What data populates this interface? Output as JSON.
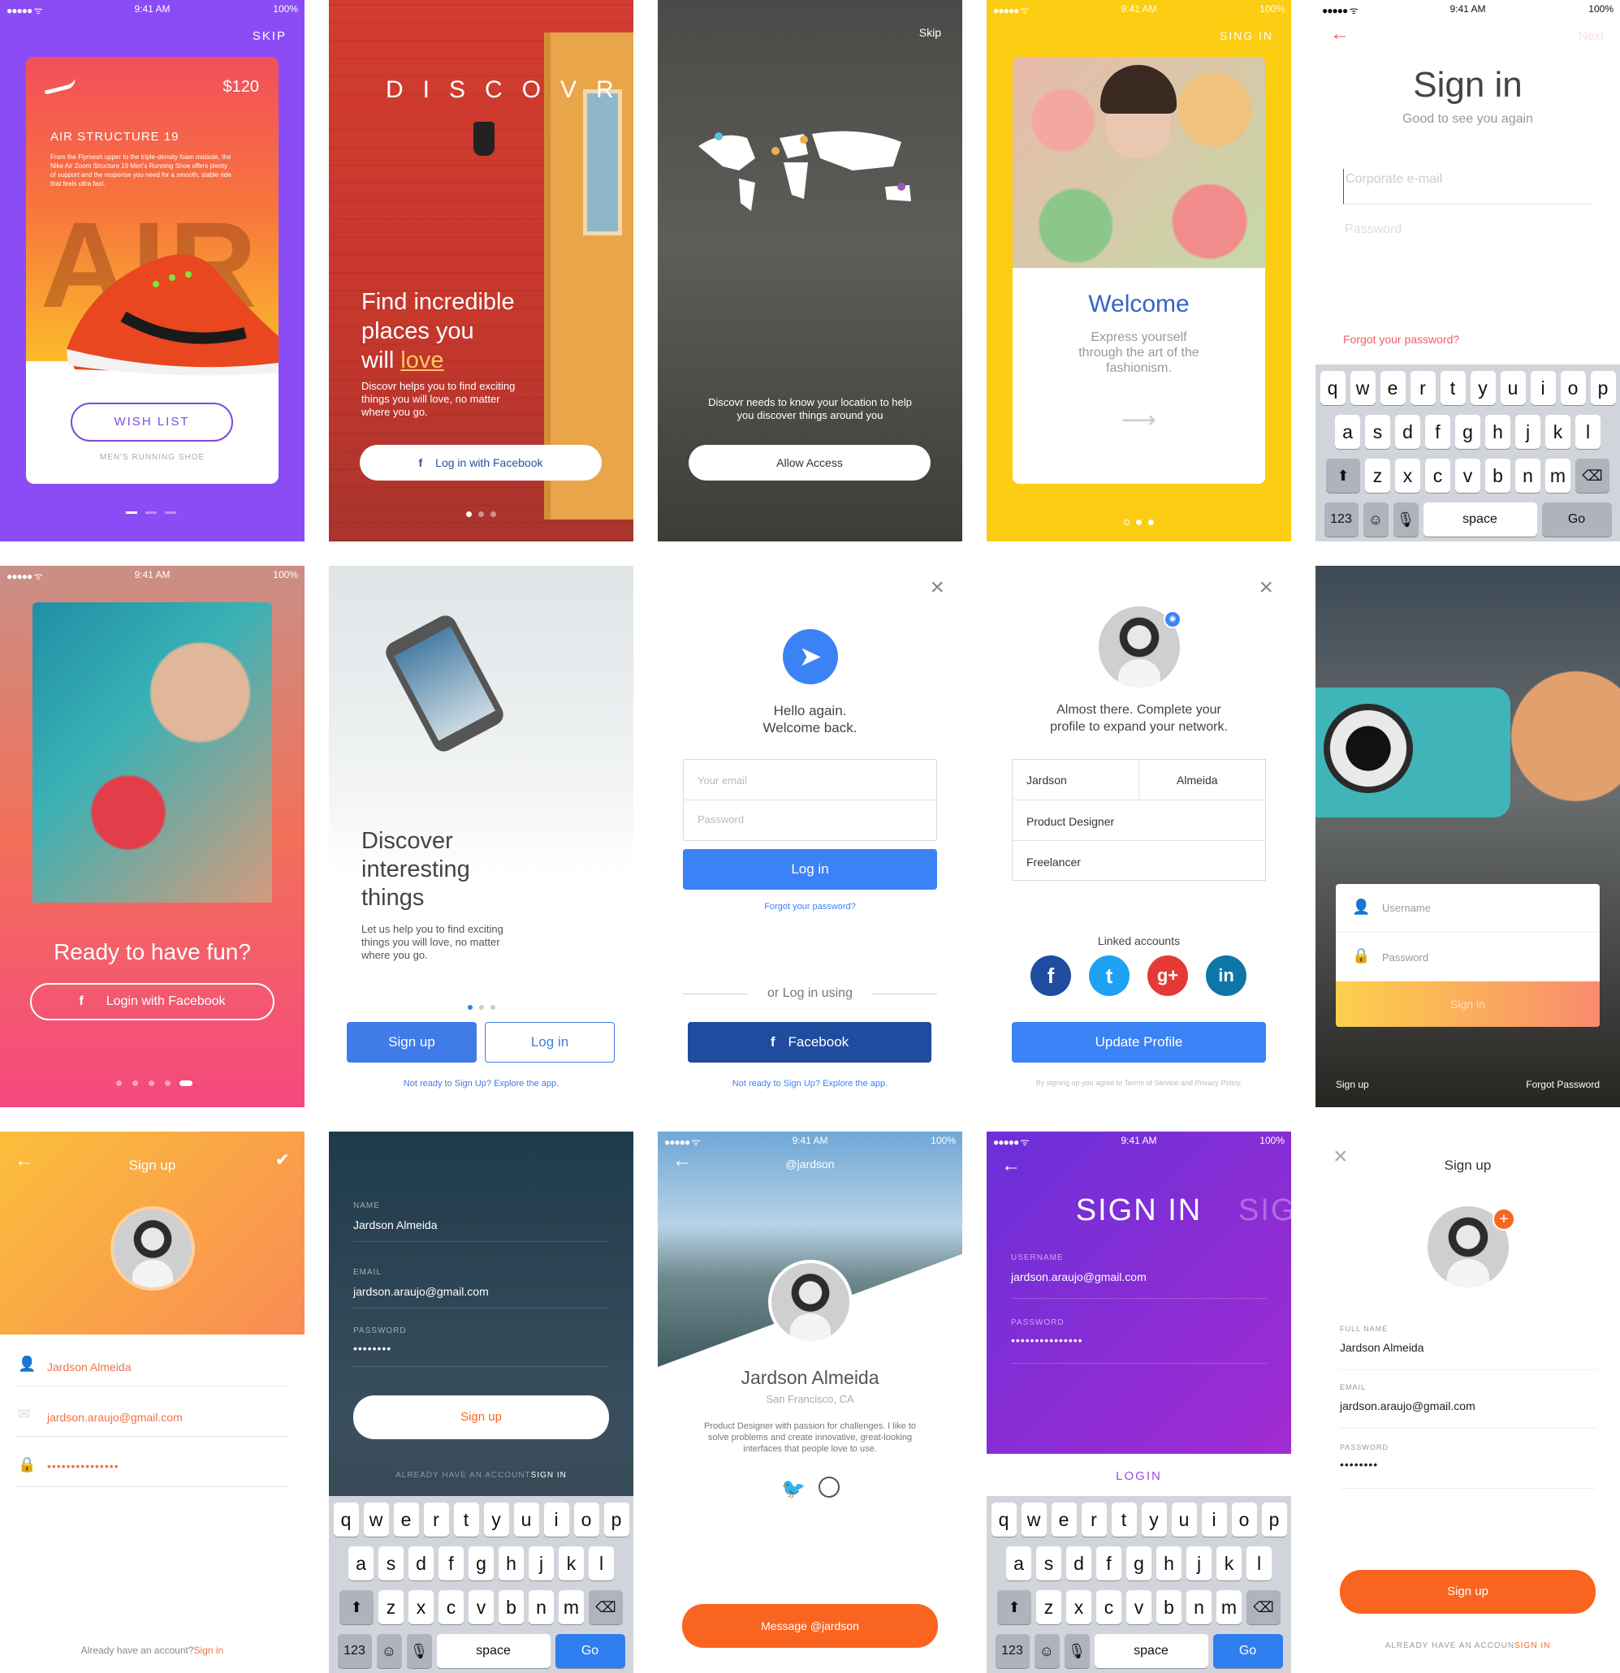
{
  "status": {
    "time": "9:41 AM",
    "battery": "100%",
    "signal": "●●●●● ᯤ"
  },
  "s1": {
    "skip": "SKIP",
    "price": "$120",
    "product": "AIR STRUCTURE 19",
    "description": "From the Flymesh upper to the triple-density foam midsole, the Nike Air Zoom Structure 19 Men's Running Shoe offers plenty of support and the response you need for a smooth, stable ride that feels ultra fast.",
    "bg_word": "AIR",
    "wishlist": "WISH LIST",
    "category": "MEN'S RUNNING SHOE"
  },
  "s2": {
    "brand": "DISCOVR",
    "headline1": "Find incredible",
    "headline2": "places you",
    "headline3": "will",
    "headline_accent": "love",
    "body": "Discovr helps you to find exciting things you will love, no matter where you go.",
    "fb_button": "Log in with Facebook"
  },
  "s3": {
    "skip": "Skip",
    "body": "Discovr needs to know your location to help you discover things around you",
    "allow": "Allow Access"
  },
  "s4": {
    "sign_in": "SING IN",
    "title": "Welcome",
    "body": "Express yourself through the art of the fashionism."
  },
  "s5": {
    "next": "Next",
    "title": "Sign in",
    "subtitle": "Good to see you again",
    "email_placeholder": "Corporate e-mail",
    "password_placeholder": "Password",
    "forgot": "Forgot your password?"
  },
  "keyboard": {
    "row1": [
      "q",
      "w",
      "e",
      "r",
      "t",
      "y",
      "u",
      "i",
      "o",
      "p"
    ],
    "row2": [
      "a",
      "s",
      "d",
      "f",
      "g",
      "h",
      "j",
      "k",
      "l"
    ],
    "row3": [
      "z",
      "x",
      "c",
      "v",
      "b",
      "n",
      "m"
    ],
    "num": "123",
    "space": "space",
    "go": "Go"
  },
  "s6": {
    "title": "Ready to have fun?",
    "fb_button": "Login with Facebook"
  },
  "s7": {
    "headline1": "Discover",
    "headline2": "interesting",
    "headline3": "things",
    "body": "Let us  help you to find exciting things you will love, no matter where you go.",
    "signup": "Sign up",
    "login": "Log in",
    "explore": "Not ready to Sign Up? Explore the app."
  },
  "s8": {
    "greeting1": "Hello again.",
    "greeting2": "Welcome back.",
    "email_placeholder": "Your email",
    "password_placeholder": "Password",
    "login": "Log in",
    "forgot": "Forgot your password?",
    "or": "or Log in using",
    "facebook": "Facebook",
    "explore": "Not ready to Sign Up? Explore the app."
  },
  "s9": {
    "text1": "Almost there. Complete your",
    "text2": "profile to expand your network.",
    "first_name": "Jardson",
    "last_name": "Almeida",
    "title": "Product Designer",
    "status": "Freelancer",
    "linked": "Linked accounts",
    "update": "Update Profile",
    "legal": "By signing up you agree to Terms of Service and Privacy Policy.",
    "social": [
      "f",
      "t",
      "g+",
      "in"
    ]
  },
  "s10": {
    "username_placeholder": "Username",
    "password_placeholder": "Password",
    "signin": "Sign in",
    "signup": "Sign up",
    "forgot": "Forgot Password"
  },
  "s11": {
    "title": "Sign up",
    "name": "Jardson Almeida",
    "email": "jardson.araujo@gmail.com",
    "password": "•••••••••••••••",
    "footer": "Already have an account?",
    "footer_link": "Sign in"
  },
  "s12": {
    "name_label": "NAME",
    "name": "Jardson Almeida",
    "email_label": "EMAIL",
    "email": "jardson.araujo@gmail.com",
    "password_label": "PASSWORD",
    "password": "••••••••",
    "signup": "Sign up",
    "footer": "ALREADY HAVE AN ACCOUNT",
    "footer_link": "SIGN IN"
  },
  "s13": {
    "handle": "@jardson",
    "name": "Jardson Almeida",
    "location": "San Francisco, CA",
    "bio": "Product Designer with passion for challenges. I like to solve problems and create innovative, great-looking interfaces that people love to use.",
    "message": "Message @jardson"
  },
  "s14": {
    "title": "SIGN IN",
    "title_ghost": "SIG",
    "username_label": "USERNAME",
    "username": "jardson.araujo@gmail.com",
    "password_label": "PASSWORD",
    "password": "•••••••••••••••",
    "login": "LOGIN"
  },
  "s15": {
    "title": "Sign up",
    "fullname_label": "FULL NAME",
    "fullname": "Jardson Almeida",
    "email_label": "EMAIL",
    "email": "jardson.araujo@gmail.com",
    "password_label": "PASSWORD",
    "password": "••••••••",
    "signup": "Sign up",
    "footer": "ALREADY HAVE AN ACCOUN",
    "footer_link": "SIGN IN"
  },
  "colors": {
    "purple": "#8a4cf6",
    "red": "#d63b2f",
    "yellow": "#fccd12",
    "blue": "#3b82f6",
    "orange": "#f96521",
    "fb_blue": "#1f4c9f"
  }
}
